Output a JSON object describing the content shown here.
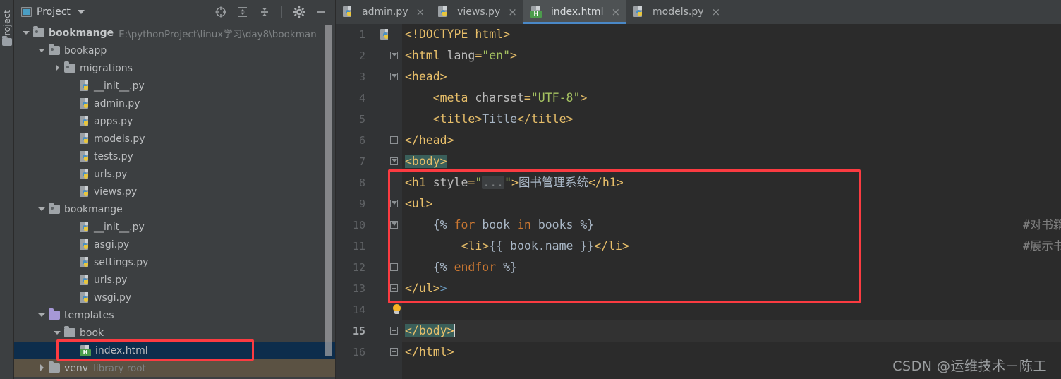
{
  "window": {
    "tool_strip_label": "Project",
    "watermark": "CSDN @运维技术－陈工"
  },
  "project_panel": {
    "title": "Project",
    "caret_icon": "chevron-down-icon",
    "header_icons": [
      {
        "name": "locate-target-icon",
        "tooltip": "Select Opened File"
      },
      {
        "name": "expand-all-icon",
        "tooltip": "Expand All"
      },
      {
        "name": "collapse-all-icon",
        "tooltip": "Collapse All"
      },
      {
        "name": "gear-icon",
        "tooltip": "Settings"
      },
      {
        "name": "minimize-icon",
        "tooltip": "Hide"
      }
    ],
    "tree": [
      {
        "label": "bookmange",
        "sub": "E:\\pythonProject\\linux学习\\day8\\bookman",
        "depth": 0,
        "kind": "folder-root",
        "state": "open",
        "bold": true
      },
      {
        "label": "bookapp",
        "sub": "",
        "depth": 1,
        "kind": "folder-module",
        "state": "open",
        "bold": false
      },
      {
        "label": "migrations",
        "sub": "",
        "depth": 2,
        "kind": "folder-module",
        "state": "closed",
        "bold": false
      },
      {
        "label": "__init__.py",
        "sub": "",
        "depth": 3,
        "kind": "python",
        "state": "",
        "bold": false
      },
      {
        "label": "admin.py",
        "sub": "",
        "depth": 3,
        "kind": "python",
        "state": "",
        "bold": false
      },
      {
        "label": "apps.py",
        "sub": "",
        "depth": 3,
        "kind": "python",
        "state": "",
        "bold": false
      },
      {
        "label": "models.py",
        "sub": "",
        "depth": 3,
        "kind": "python",
        "state": "",
        "bold": false
      },
      {
        "label": "tests.py",
        "sub": "",
        "depth": 3,
        "kind": "python",
        "state": "",
        "bold": false
      },
      {
        "label": "urls.py",
        "sub": "",
        "depth": 3,
        "kind": "python",
        "state": "",
        "bold": false
      },
      {
        "label": "views.py",
        "sub": "",
        "depth": 3,
        "kind": "python",
        "state": "",
        "bold": false
      },
      {
        "label": "bookmange",
        "sub": "",
        "depth": 1,
        "kind": "folder-module",
        "state": "open",
        "bold": false
      },
      {
        "label": "__init__.py",
        "sub": "",
        "depth": 3,
        "kind": "python",
        "state": "",
        "bold": false
      },
      {
        "label": "asgi.py",
        "sub": "",
        "depth": 3,
        "kind": "python",
        "state": "",
        "bold": false
      },
      {
        "label": "settings.py",
        "sub": "",
        "depth": 3,
        "kind": "python",
        "state": "",
        "bold": false
      },
      {
        "label": "urls.py",
        "sub": "",
        "depth": 3,
        "kind": "python",
        "state": "",
        "bold": false
      },
      {
        "label": "wsgi.py",
        "sub": "",
        "depth": 3,
        "kind": "python",
        "state": "",
        "bold": false
      },
      {
        "label": "templates",
        "sub": "",
        "depth": 1,
        "kind": "folder-templates",
        "state": "open",
        "bold": false
      },
      {
        "label": "book",
        "sub": "",
        "depth": 2,
        "kind": "folder-plain",
        "state": "open",
        "bold": false
      },
      {
        "label": "index.html",
        "sub": "",
        "depth": 3,
        "kind": "html",
        "state": "",
        "bold": false,
        "selected": true
      },
      {
        "label": "venv",
        "sub": "library root",
        "depth": 1,
        "kind": "folder-plain",
        "state": "closed",
        "bold": false,
        "hovered": true
      }
    ]
  },
  "editor": {
    "tabs": [
      {
        "label": "admin.py",
        "icon": "python-file-icon",
        "active": false,
        "close": "×"
      },
      {
        "label": "views.py",
        "icon": "python-file-icon",
        "active": false,
        "close": "×"
      },
      {
        "label": "index.html",
        "icon": "html-file-icon",
        "active": true,
        "close": "×"
      },
      {
        "label": "models.py",
        "icon": "python-file-icon",
        "active": false,
        "close": "×"
      }
    ],
    "html_badge": "H",
    "lines": [
      {
        "n": "1",
        "text": "<!DOCTYPE html>"
      },
      {
        "n": "2",
        "text": "<html lang=\"en\">"
      },
      {
        "n": "3",
        "text": "<head>"
      },
      {
        "n": "4",
        "text": "    <meta charset=\"UTF-8\">"
      },
      {
        "n": "5",
        "text": "    <title>Title</title>"
      },
      {
        "n": "6",
        "text": "</head>"
      },
      {
        "n": "7",
        "text": "<body>"
      },
      {
        "n": "8",
        "text": "<h1 style=\"...\">图书管理系统</h1>"
      },
      {
        "n": "9",
        "text": "<ul>"
      },
      {
        "n": "10",
        "text": "    {% for book in books %}",
        "comment": "#对书籍进行遍历"
      },
      {
        "n": "11",
        "text": "        <li>{{ book.name }}</li>",
        "comment": "#展示书籍的名字"
      },
      {
        "n": "12",
        "text": "    {% endfor %}"
      },
      {
        "n": "13",
        "text": "</ul>>"
      },
      {
        "n": "14",
        "text": ""
      },
      {
        "n": "15",
        "text": "</body>",
        "current": true
      },
      {
        "n": "16",
        "text": "</html>"
      }
    ],
    "fold_placeholder": "...",
    "intention_bulb": "lightbulb-icon",
    "annotation_color": "#fb3b41"
  }
}
